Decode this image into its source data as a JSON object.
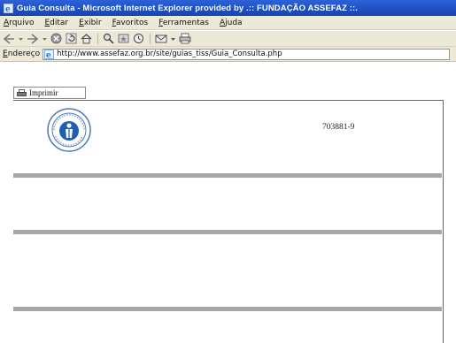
{
  "window": {
    "title": "Guia Consulta - Microsoft Internet Explorer provided by .:: FUNDAÇÃO ASSEFAZ ::."
  },
  "menu": {
    "items": [
      "Arquivo",
      "Editar",
      "Exibir",
      "Favoritos",
      "Ferramentas",
      "Ajuda"
    ]
  },
  "toolbar": {
    "icons": [
      "back-icon",
      "forward-icon",
      "stop-icon",
      "refresh-icon",
      "home-icon",
      "search-icon",
      "favorites-icon",
      "history-icon",
      "mail-icon",
      "print-icon"
    ]
  },
  "address": {
    "label": "Endereço",
    "url": "http://www.assefaz.org.br/site/guias_tiss/Guia_Consulta.php"
  },
  "page": {
    "print_label": "Imprimir",
    "doc_number": "703881-9",
    "section_bar_color": "#a6a6a6"
  },
  "colors": {
    "title_bar": "#1d4fc0",
    "chrome": "#ece9d8"
  }
}
